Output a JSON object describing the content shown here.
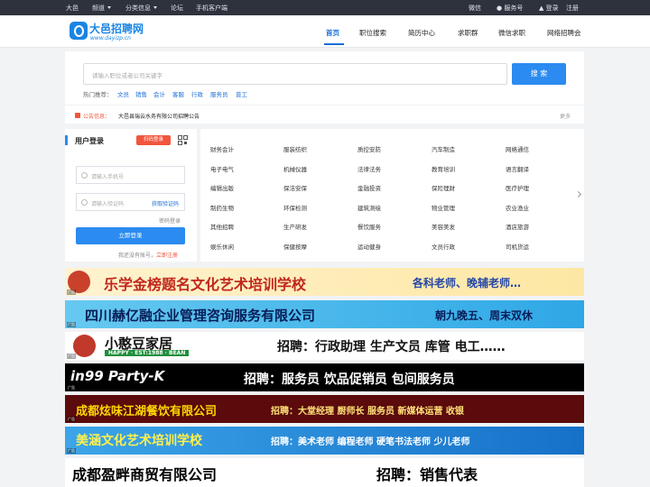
{
  "topbar": {
    "city": "大邑",
    "channel": "频道",
    "classified": "分类信息",
    "forum": "论坛",
    "mobile": "手机客户端",
    "wechat": "微信",
    "service": "服务号",
    "login": "登录",
    "register": "注册"
  },
  "header": {
    "logo_title": "大邑招聘网",
    "logo_url": "www.dayizp.cn",
    "nav": [
      "首页",
      "职位搜索",
      "简历中心",
      "求职群",
      "微信求职",
      "网络招聘会"
    ]
  },
  "search": {
    "placeholder": "请输入职位或者公司关键字",
    "button": "搜 索",
    "hot_label": "热门推荐：",
    "hot": [
      "文员",
      "销售",
      "会计",
      "客服",
      "行政",
      "服务员",
      "普工"
    ]
  },
  "notice": {
    "label": "公告信息：",
    "text": "大邑县瑞云水务有限公司招聘公告",
    "more": "更多"
  },
  "login": {
    "title": "用户登录",
    "scan": "扫码登录",
    "phone_placeholder": "请输入手机号",
    "code_placeholder": "请输入验证码",
    "get_code": "获取验证码",
    "password_login": "密码登录",
    "submit": "立即登录",
    "no_account": "我还没有账号，",
    "register_now": "立即注册"
  },
  "categories": [
    [
      "财务会计",
      "服装纺织",
      "质控安防",
      "汽车制造",
      "网络通信"
    ],
    [
      "电子电气",
      "机械仪器",
      "法律法务",
      "教育培训",
      "语言翻译"
    ],
    [
      "编辑出版",
      "保洁安保",
      "金融投资",
      "保险理财",
      "医疗护理"
    ],
    [
      "制药生物",
      "环保检测",
      "建筑测绘",
      "物业管理",
      "农业渔业"
    ],
    [
      "其他招聘",
      "生产研发",
      "餐饮服务",
      "美容美发",
      "酒店旅游"
    ],
    [
      "娱乐休闲",
      "保健按摩",
      "运动健身",
      "文员行政",
      "司机货运"
    ]
  ],
  "banners": [
    {
      "title": "乐学金榜题名文化艺术培训学校",
      "extra": "各科老师、晚辅老师…"
    },
    {
      "title": "四川赫亿融企业管理咨询服务有限公司",
      "extra": "朝九晚五、周末双休"
    },
    {
      "title": "小憨豆家居",
      "sub": "HAPPY · EST:1988 · BEAN",
      "extra": "招聘：行政助理 生产文员 库管 电工……"
    },
    {
      "title": "in99 Party-K",
      "extra": "招聘：服务员 饮品促销员 包间服务员"
    },
    {
      "title": "成都炫味江湖餐饮有限公司",
      "extra": "招聘：大堂经理 厨师长 服务员 新媒体运营 收银"
    },
    {
      "title": "美涵文化艺术培训学校",
      "extra": "招聘：美术老师 编程老师 硬笔书法老师 少儿老师"
    },
    {
      "title": "成都盈畔商贸有限公司",
      "extra": "招聘：销售代表"
    }
  ],
  "ad_tag": "广告",
  "colors": {
    "accent": "#2b8bf0",
    "topbar": "#2d323c",
    "alert": "#f2553d"
  }
}
